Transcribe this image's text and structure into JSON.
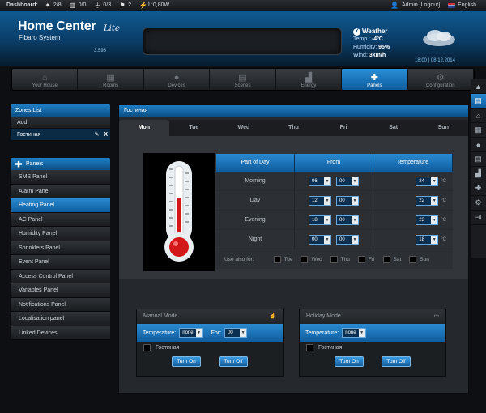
{
  "topbar": {
    "dashboard_label": "Dashboard:",
    "stats": [
      {
        "icon": "bulb-icon",
        "value": "2/8"
      },
      {
        "icon": "blind-icon",
        "value": "0/0"
      },
      {
        "icon": "plug-icon",
        "value": "0/3"
      },
      {
        "icon": "flag-icon",
        "value": "2"
      },
      {
        "icon": "bolt-icon",
        "value": "L:0,80W"
      }
    ],
    "user": "Admin [Logout]",
    "language": "English"
  },
  "header": {
    "brand": "Home Center",
    "brand_lite": "Lite",
    "brand_sub": "Fibaro System",
    "version": "3.593",
    "weather": {
      "title": "Weather",
      "temp_label": "Temp.:",
      "temp": "-4ºC",
      "humidity_label": "Humidity:",
      "humidity": "95%",
      "wind_label": "Wind:",
      "wind": "3km/h"
    },
    "datetime": "18:00 | 08.12.2014"
  },
  "nav": [
    {
      "label": "Your House",
      "icon": "house-icon",
      "active": false
    },
    {
      "label": "Rooms",
      "icon": "rooms-icon",
      "active": false
    },
    {
      "label": "Devices",
      "icon": "bulb-icon",
      "active": false
    },
    {
      "label": "Scenes",
      "icon": "scenes-icon",
      "active": false
    },
    {
      "label": "Energy",
      "icon": "energy-icon",
      "active": false
    },
    {
      "label": "Panels",
      "icon": "puzzle-icon",
      "active": true
    },
    {
      "label": "Configuration",
      "icon": "gear-icon",
      "active": false
    }
  ],
  "zones": {
    "title": "Zones List",
    "add": "Add",
    "selected": "Гостиная"
  },
  "panels": {
    "title": "Panels",
    "items": [
      "SMS Panel",
      "Alarm Panel",
      "Heating Panel",
      "AC Panel",
      "Humidity Panel",
      "Sprinklers Panel",
      "Event Panel",
      "Access Control Panel",
      "Variables Panel",
      "Notifications Panel",
      "Localisation panel",
      "Linked Devices"
    ],
    "selected_index": 2
  },
  "main": {
    "title": "Гостиная",
    "days": [
      "Mon",
      "Tue",
      "Wed",
      "Thu",
      "Fri",
      "Sat",
      "Sun"
    ],
    "active_day": 0,
    "schedule": {
      "headers": [
        "Part of Day",
        "From",
        "Temperature"
      ],
      "rows": [
        {
          "part": "Morning",
          "hour": "06",
          "min": "00",
          "temp": "24",
          "unit": "°C"
        },
        {
          "part": "Day",
          "hour": "12",
          "min": "00",
          "temp": "22",
          "unit": "°C"
        },
        {
          "part": "Evening",
          "hour": "18",
          "min": "00",
          "temp": "23",
          "unit": "°C"
        },
        {
          "part": "Night",
          "hour": "00",
          "min": "00",
          "temp": "18",
          "unit": "°C"
        }
      ],
      "use_also_for": "Use also for:",
      "use_days": [
        "Tue",
        "Wed",
        "Thu",
        "Fri",
        "Sat",
        "Sun"
      ]
    },
    "manual": {
      "title": "Manual Mode",
      "temperature_label": "Temperature:",
      "temperature_value": "none",
      "for_label": "For:",
      "for_value": "00",
      "room": "Гостиная",
      "turn_on": "Turn On",
      "turn_off": "Turn Off"
    },
    "holiday": {
      "title": "Holiday Mode",
      "temperature_label": "Temperature:",
      "temperature_value": "none",
      "room": "Гостиная",
      "turn_on": "Turn On",
      "turn_off": "Turn Off"
    }
  },
  "colors": {
    "accent": "#1f7ec4",
    "header": "#0f5a92",
    "background": "#0d0f12"
  }
}
